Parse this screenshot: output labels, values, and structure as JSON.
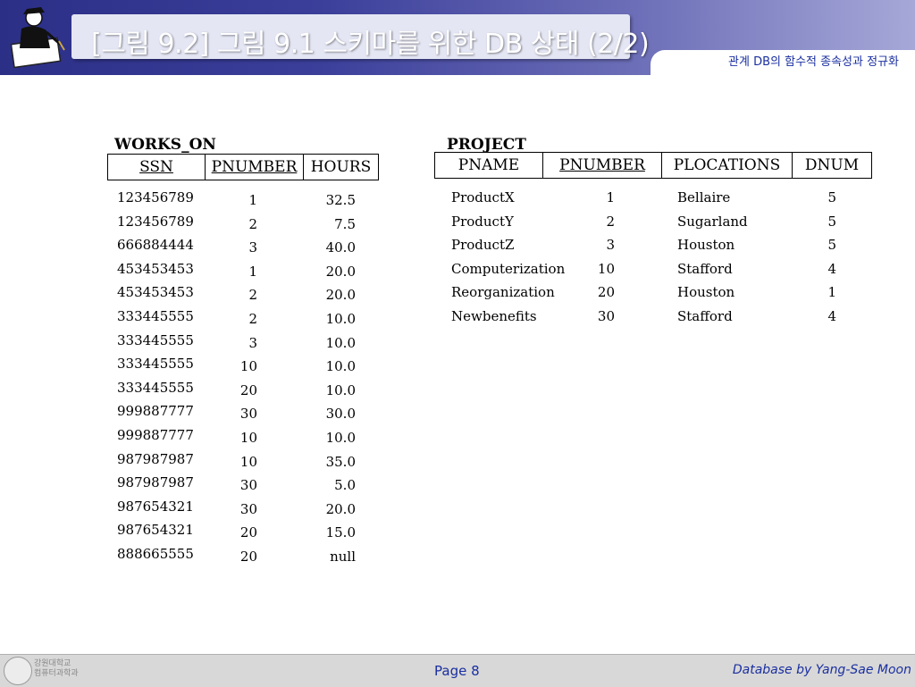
{
  "header": {
    "title": "[그림 9.2] 그림 9.1 스키마를 위한 DB 상태 (2/2)",
    "subtitle": "관계 DB의 함수적 종속성과 정규화"
  },
  "works_on": {
    "title": "WORKS_ON",
    "columns": [
      "SSN",
      "PNUMBER",
      "HOURS"
    ],
    "rows": [
      [
        "123456789",
        "1",
        "32.5"
      ],
      [
        "123456789",
        "2",
        "7.5"
      ],
      [
        "666884444",
        "3",
        "40.0"
      ],
      [
        "453453453",
        "1",
        "20.0"
      ],
      [
        "453453453",
        "2",
        "20.0"
      ],
      [
        "333445555",
        "2",
        "10.0"
      ],
      [
        "333445555",
        "3",
        "10.0"
      ],
      [
        "333445555",
        "10",
        "10.0"
      ],
      [
        "333445555",
        "20",
        "10.0"
      ],
      [
        "999887777",
        "30",
        "30.0"
      ],
      [
        "999887777",
        "10",
        "10.0"
      ],
      [
        "987987987",
        "10",
        "35.0"
      ],
      [
        "987987987",
        "30",
        "5.0"
      ],
      [
        "987654321",
        "30",
        "20.0"
      ],
      [
        "987654321",
        "20",
        "15.0"
      ],
      [
        "888665555",
        "20",
        "null"
      ]
    ]
  },
  "project": {
    "title": "PROJECT",
    "columns": [
      "PNAME",
      "PNUMBER",
      "PLOCATIONS",
      "DNUM"
    ],
    "rows": [
      [
        "ProductX",
        "1",
        "Bellaire",
        "5"
      ],
      [
        "ProductY",
        "2",
        "Sugarland",
        "5"
      ],
      [
        "ProductZ",
        "3",
        "Houston",
        "5"
      ],
      [
        "Computerization",
        "10",
        "Stafford",
        "4"
      ],
      [
        "Reorganization",
        "20",
        "Houston",
        "1"
      ],
      [
        "Newbenefits",
        "30",
        "Stafford",
        "4"
      ]
    ]
  },
  "footer": {
    "logo_text_1": "강원대학교",
    "logo_text_2": "컴퓨터과학과",
    "page": "Page 8",
    "credit": "Database by Yang-Sae Moon"
  },
  "colors": {
    "header_dark": "#2c2f86",
    "accent_text": "#1a2fa0"
  }
}
